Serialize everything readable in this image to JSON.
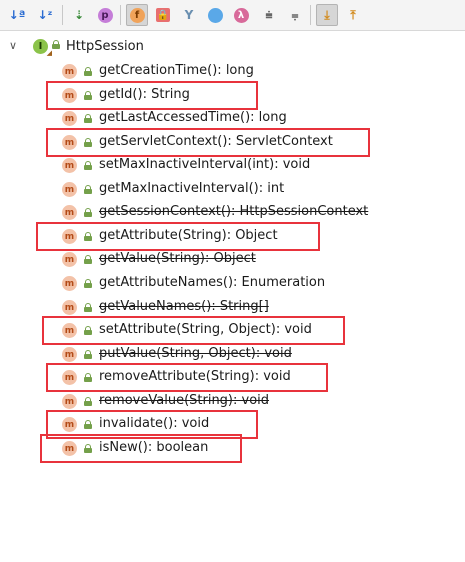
{
  "toolbar": {
    "buttons": [
      {
        "icon": "sort-by-visibility-icon",
        "glyph": "↓a"
      },
      {
        "icon": "sort-alphabetically-icon",
        "glyph": "↓z"
      },
      {
        "icon": "show-fields-icon",
        "glyph": "f"
      },
      {
        "icon": "show-properties-icon",
        "glyph": "p"
      },
      {
        "icon": "show-fields-toggle-icon",
        "glyph": "f"
      },
      {
        "icon": "show-non-public-icon",
        "glyph": "🔒"
      },
      {
        "icon": "show-inherited-icon",
        "glyph": "Y"
      },
      {
        "icon": "show-anonymous-icon",
        "glyph": "○"
      },
      {
        "icon": "show-lambdas-icon",
        "glyph": "λ"
      },
      {
        "icon": "expand-all-icon",
        "glyph": "≡"
      },
      {
        "icon": "collapse-all-icon",
        "glyph": "≡"
      },
      {
        "icon": "autoscroll-to-source-icon",
        "glyph": "⤓"
      },
      {
        "icon": "autoscroll-from-source-icon",
        "glyph": "⤒"
      }
    ]
  },
  "tree": {
    "root": {
      "label": "HttpSession",
      "icon_letter": "I"
    },
    "method_letter": "m",
    "methods": [
      {
        "label": "getCreationTime(): long",
        "deprecated": false,
        "highlighted": false
      },
      {
        "label": "getId(): String",
        "deprecated": false,
        "highlighted": true
      },
      {
        "label": "getLastAccessedTime(): long",
        "deprecated": false,
        "highlighted": false
      },
      {
        "label": "getServletContext(): ServletContext",
        "deprecated": false,
        "highlighted": true
      },
      {
        "label": "setMaxInactiveInterval(int): void",
        "deprecated": false,
        "highlighted": false
      },
      {
        "label": "getMaxInactiveInterval(): int",
        "deprecated": false,
        "highlighted": false
      },
      {
        "label": "getSessionContext(): HttpSessionContext",
        "deprecated": true,
        "highlighted": false
      },
      {
        "label": "getAttribute(String): Object",
        "deprecated": false,
        "highlighted": true
      },
      {
        "label": "getValue(String): Object",
        "deprecated": true,
        "highlighted": false
      },
      {
        "label": "getAttributeNames(): Enumeration",
        "deprecated": false,
        "highlighted": false
      },
      {
        "label": "getValueNames(): String[]",
        "deprecated": true,
        "highlighted": false
      },
      {
        "label": "setAttribute(String, Object): void",
        "deprecated": false,
        "highlighted": true
      },
      {
        "label": "putValue(String, Object): void",
        "deprecated": true,
        "highlighted": false
      },
      {
        "label": "removeAttribute(String): void",
        "deprecated": false,
        "highlighted": true
      },
      {
        "label": "removeValue(String): void",
        "deprecated": true,
        "highlighted": false
      },
      {
        "label": "invalidate(): void",
        "deprecated": false,
        "highlighted": true
      },
      {
        "label": "isNew(): boolean",
        "deprecated": false,
        "highlighted": true
      }
    ]
  },
  "colors": {
    "highlight_box": "#e8333c",
    "method_icon_bg": "#f3c2a8",
    "interface_icon_bg": "#8bc34a"
  }
}
